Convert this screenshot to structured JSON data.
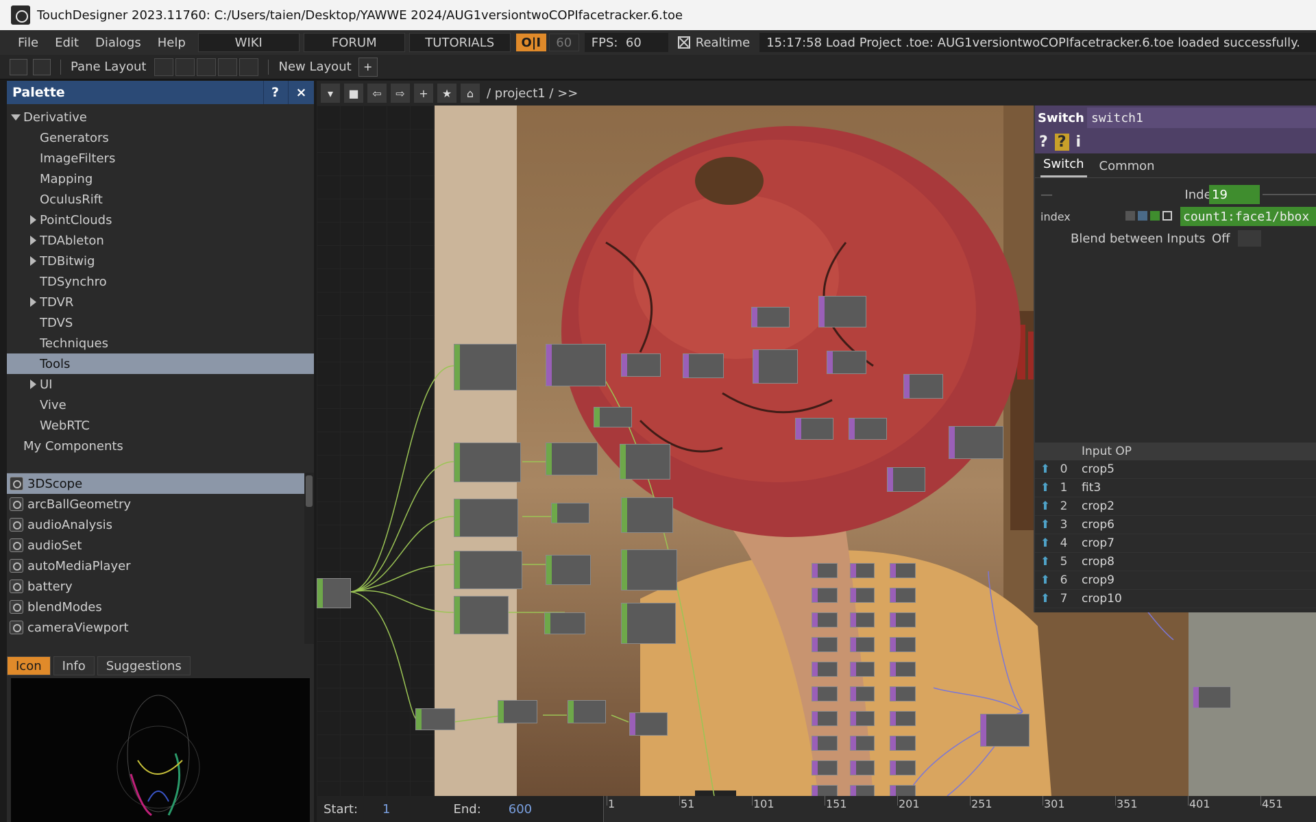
{
  "window": {
    "title": "TouchDesigner 2023.11760: C:/Users/taien/Desktop/YAWWE 2024/AUG1versiontwoCOPIfacetracker.6.toe"
  },
  "menubar": {
    "menus": [
      "File",
      "Edit",
      "Dialogs",
      "Help"
    ],
    "links": [
      "WIKI",
      "FORUM",
      "TUTORIALS"
    ],
    "oi_label": "O|I",
    "cook_rate": "60",
    "fps_label": "FPS:",
    "fps_value": "60",
    "realtime_label": "Realtime",
    "realtime_checked": true,
    "status_message": "15:17:58 Load Project .toe: AUG1versiontwoCOPIfacetracker.6.toe loaded successfully."
  },
  "panebar": {
    "pane_layout_label": "Pane Layout",
    "new_layout_label": "New Layout",
    "add_label": "+"
  },
  "palette": {
    "title": "Palette",
    "help": "?",
    "close": "×",
    "tree": [
      {
        "label": "Derivative",
        "expand": "open",
        "indent": 0
      },
      {
        "label": "Generators",
        "expand": "none",
        "indent": 1
      },
      {
        "label": "ImageFilters",
        "expand": "none",
        "indent": 1
      },
      {
        "label": "Mapping",
        "expand": "none",
        "indent": 1
      },
      {
        "label": "OculusRift",
        "expand": "none",
        "indent": 1
      },
      {
        "label": "PointClouds",
        "expand": "closed",
        "indent": 1
      },
      {
        "label": "TDAbleton",
        "expand": "closed",
        "indent": 1
      },
      {
        "label": "TDBitwig",
        "expand": "closed",
        "indent": 1
      },
      {
        "label": "TDSynchro",
        "expand": "none",
        "indent": 1
      },
      {
        "label": "TDVR",
        "expand": "closed",
        "indent": 1
      },
      {
        "label": "TDVS",
        "expand": "none",
        "indent": 1
      },
      {
        "label": "Techniques",
        "expand": "none",
        "indent": 1
      },
      {
        "label": "Tools",
        "expand": "none",
        "indent": 1,
        "selected": true
      },
      {
        "label": "UI",
        "expand": "closed",
        "indent": 1
      },
      {
        "label": "Vive",
        "expand": "none",
        "indent": 1
      },
      {
        "label": "WebRTC",
        "expand": "none",
        "indent": 1
      },
      {
        "label": "My Components",
        "expand": "none",
        "indent": 0
      }
    ],
    "components": [
      "3DScope",
      "arcBallGeometry",
      "audioAnalysis",
      "audioSet",
      "autoMediaPlayer",
      "battery",
      "blendModes",
      "cameraViewport"
    ],
    "selected_component": "3DScope",
    "bottom_tabs": [
      "Icon",
      "Info",
      "Suggestions"
    ],
    "active_tab": "Icon"
  },
  "network": {
    "path": "/ project1 / >>"
  },
  "params": {
    "op_type": "Switch",
    "op_name": "switch1",
    "tabs": [
      "Switch",
      "Common"
    ],
    "active_tab": "Switch",
    "index_label": "Index",
    "index_value": "19",
    "index_expr_label": "index",
    "index_expr": "count1:face1/bbox",
    "blend_label": "Blend between Inputs",
    "blend_value": "Off",
    "input_header": "Input OP",
    "inputs": [
      "crop5",
      "fit3",
      "crop2",
      "crop6",
      "crop7",
      "crop8",
      "crop9",
      "crop10"
    ],
    "colors": {
      "header": "#4e4066",
      "expr": "#3f8d2e"
    }
  },
  "timeline": {
    "start_label": "Start:",
    "start_value": "1",
    "end_label": "End:",
    "end_value": "600",
    "ticks": [
      "1",
      "51",
      "101",
      "151",
      "201",
      "251",
      "301",
      "351",
      "401",
      "451"
    ]
  }
}
